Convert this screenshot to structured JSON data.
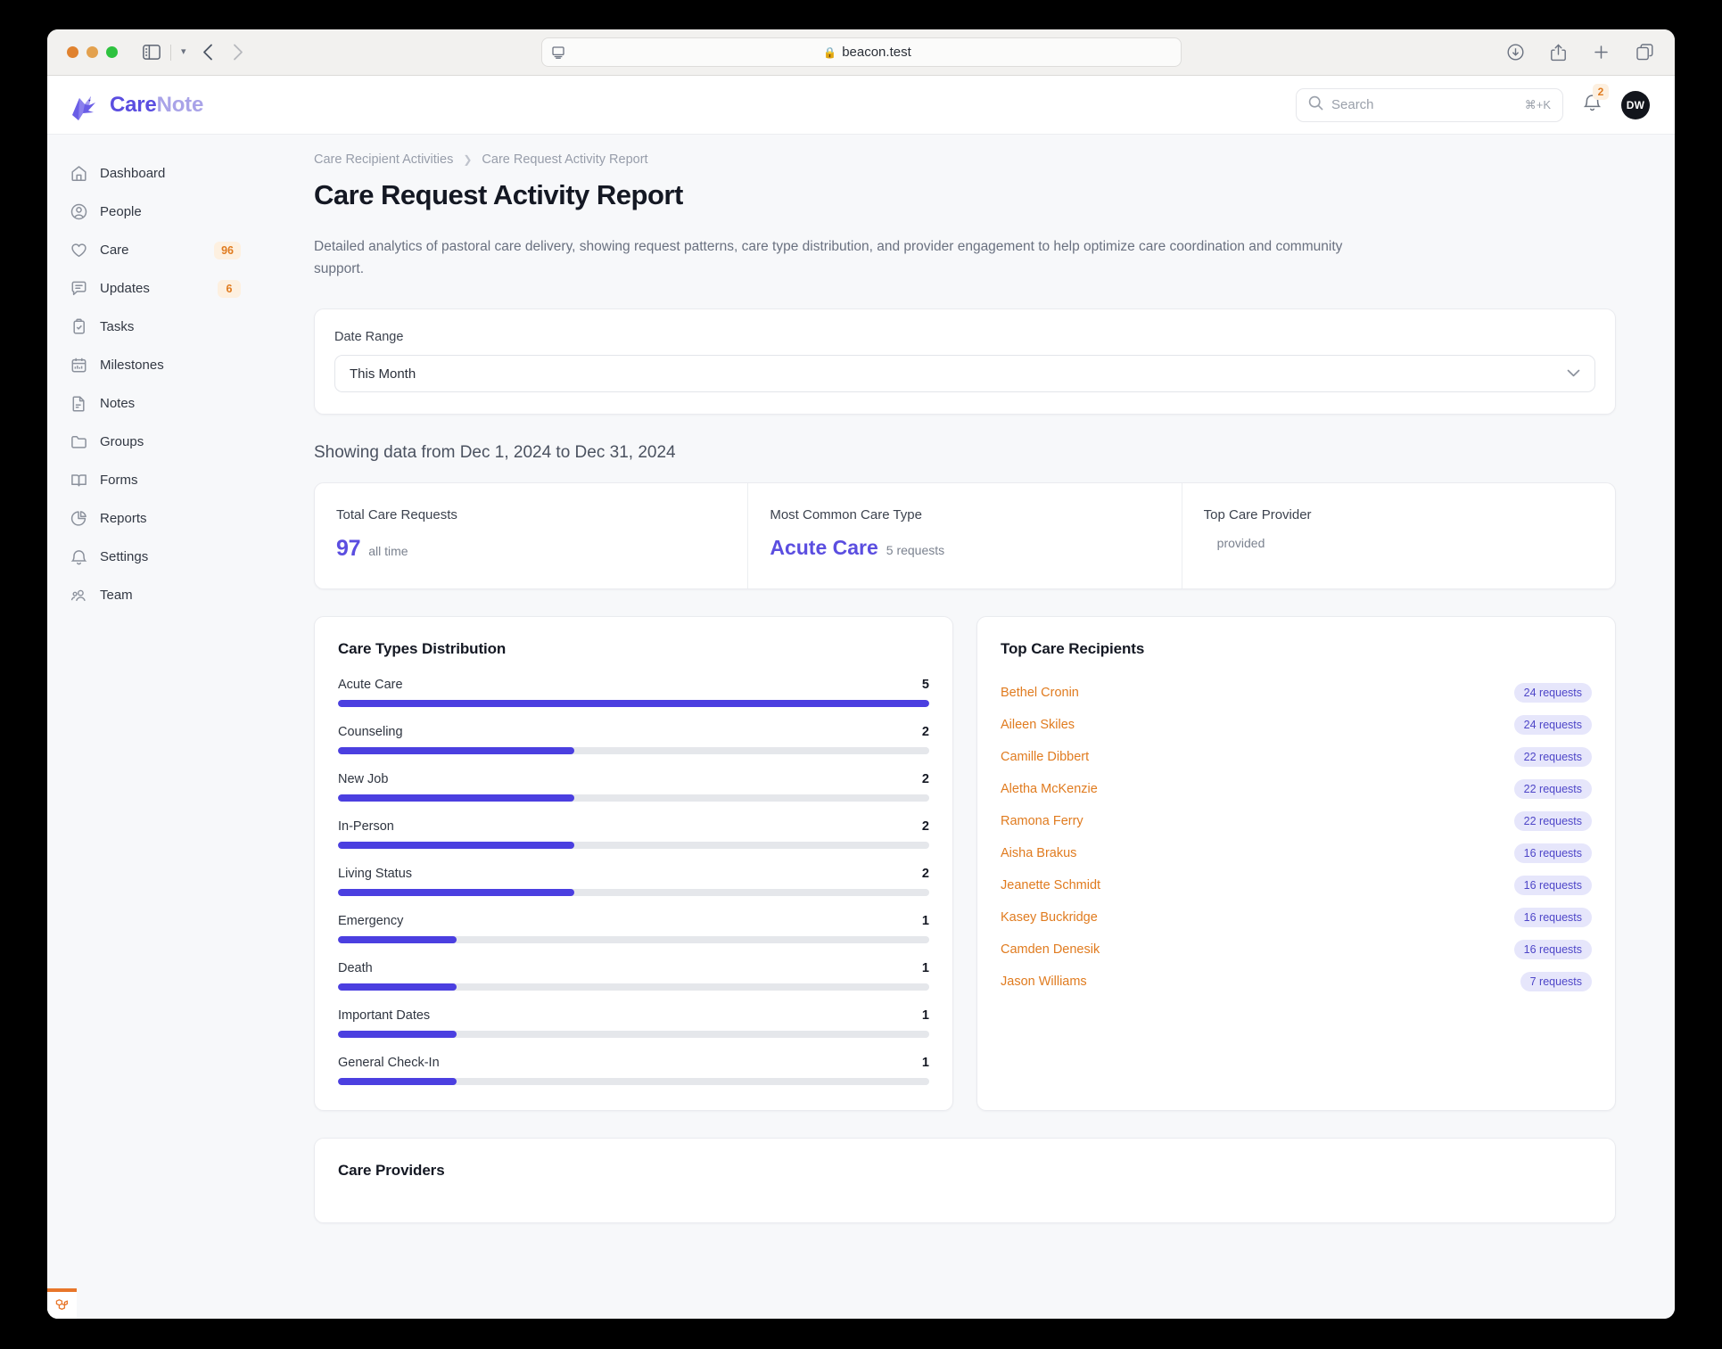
{
  "browser": {
    "url": "beacon.test",
    "lock_icon": "lock-icon",
    "icons": [
      "sidebar-toggle-icon",
      "chevron-down-icon",
      "back-arrow-icon",
      "forward-arrow-icon",
      "download-icon",
      "share-icon",
      "new-tab-icon",
      "tab-overview-icon"
    ]
  },
  "app": {
    "brand": {
      "part1": "Care",
      "part2": "Note"
    },
    "search": {
      "placeholder": "Search",
      "shortcut": "⌘+K"
    },
    "notifications": {
      "count": "2"
    },
    "avatar": {
      "initials": "DW"
    }
  },
  "sidebar": {
    "items": [
      {
        "label": "Dashboard",
        "icon": "home-icon",
        "badge": ""
      },
      {
        "label": "People",
        "icon": "user-circle-icon",
        "badge": ""
      },
      {
        "label": "Care",
        "icon": "heart-icon",
        "badge": "96"
      },
      {
        "label": "Updates",
        "icon": "chat-icon",
        "badge": "6"
      },
      {
        "label": "Tasks",
        "icon": "clipboard-check-icon",
        "badge": ""
      },
      {
        "label": "Milestones",
        "icon": "calendar-icon",
        "badge": ""
      },
      {
        "label": "Notes",
        "icon": "document-icon",
        "badge": ""
      },
      {
        "label": "Groups",
        "icon": "folder-icon",
        "badge": ""
      },
      {
        "label": "Forms",
        "icon": "book-icon",
        "badge": ""
      },
      {
        "label": "Reports",
        "icon": "pie-chart-icon",
        "badge": ""
      },
      {
        "label": "Settings",
        "icon": "bell-icon",
        "badge": ""
      },
      {
        "label": "Team",
        "icon": "users-icon",
        "badge": ""
      }
    ]
  },
  "page": {
    "breadcrumb": {
      "parent": "Care Recipient Activities",
      "current": "Care Request Activity Report"
    },
    "title": "Care Request Activity Report",
    "description": "Detailed analytics of pastoral care delivery, showing request patterns, care type distribution, and provider engagement to help optimize care coordination and community support.",
    "filter": {
      "label": "Date Range",
      "value": "This Month"
    },
    "showing": "Showing data from Dec 1, 2024 to Dec 31, 2024"
  },
  "stats": [
    {
      "label": "Total Care Requests",
      "value": "97",
      "sub": "all time"
    },
    {
      "label": "Most Common Care Type",
      "value": "Acute Care",
      "sub": "5 requests"
    },
    {
      "label": "Top Care Provider",
      "value": "",
      "sub": "provided"
    }
  ],
  "care_types_panel": {
    "title": "Care Types Distribution"
  },
  "recipients_panel": {
    "title": "Top Care Recipients"
  },
  "providers_panel": {
    "title": "Care Providers"
  },
  "recipients": [
    {
      "name": "Bethel Cronin",
      "badge": "24 requests"
    },
    {
      "name": "Aileen Skiles",
      "badge": "24 requests"
    },
    {
      "name": "Camille Dibbert",
      "badge": "22 requests"
    },
    {
      "name": "Aletha McKenzie",
      "badge": "22 requests"
    },
    {
      "name": "Ramona Ferry",
      "badge": "22 requests"
    },
    {
      "name": "Aisha Brakus",
      "badge": "16 requests"
    },
    {
      "name": "Jeanette Schmidt",
      "badge": "16 requests"
    },
    {
      "name": "Kasey Buckridge",
      "badge": "16 requests"
    },
    {
      "name": "Camden Denesik",
      "badge": "16 requests"
    },
    {
      "name": "Jason Williams",
      "badge": "7 requests"
    }
  ],
  "colors": {
    "primary": "#4b3fe0",
    "accent_orange": "#e07b1f",
    "badge_bg": "#e6e6fb",
    "track": "#e5e7eb"
  },
  "chart_data": {
    "type": "bar",
    "title": "Care Types Distribution",
    "orientation": "horizontal",
    "categories": [
      "Acute Care",
      "Counseling",
      "New Job",
      "In-Person",
      "Living Status",
      "Emergency",
      "Death",
      "Important Dates",
      "General Check-In"
    ],
    "values": [
      5,
      2,
      2,
      2,
      2,
      1,
      1,
      1,
      1
    ],
    "max": 5,
    "xlabel": "",
    "ylabel": "",
    "grid": false,
    "legend": false
  }
}
